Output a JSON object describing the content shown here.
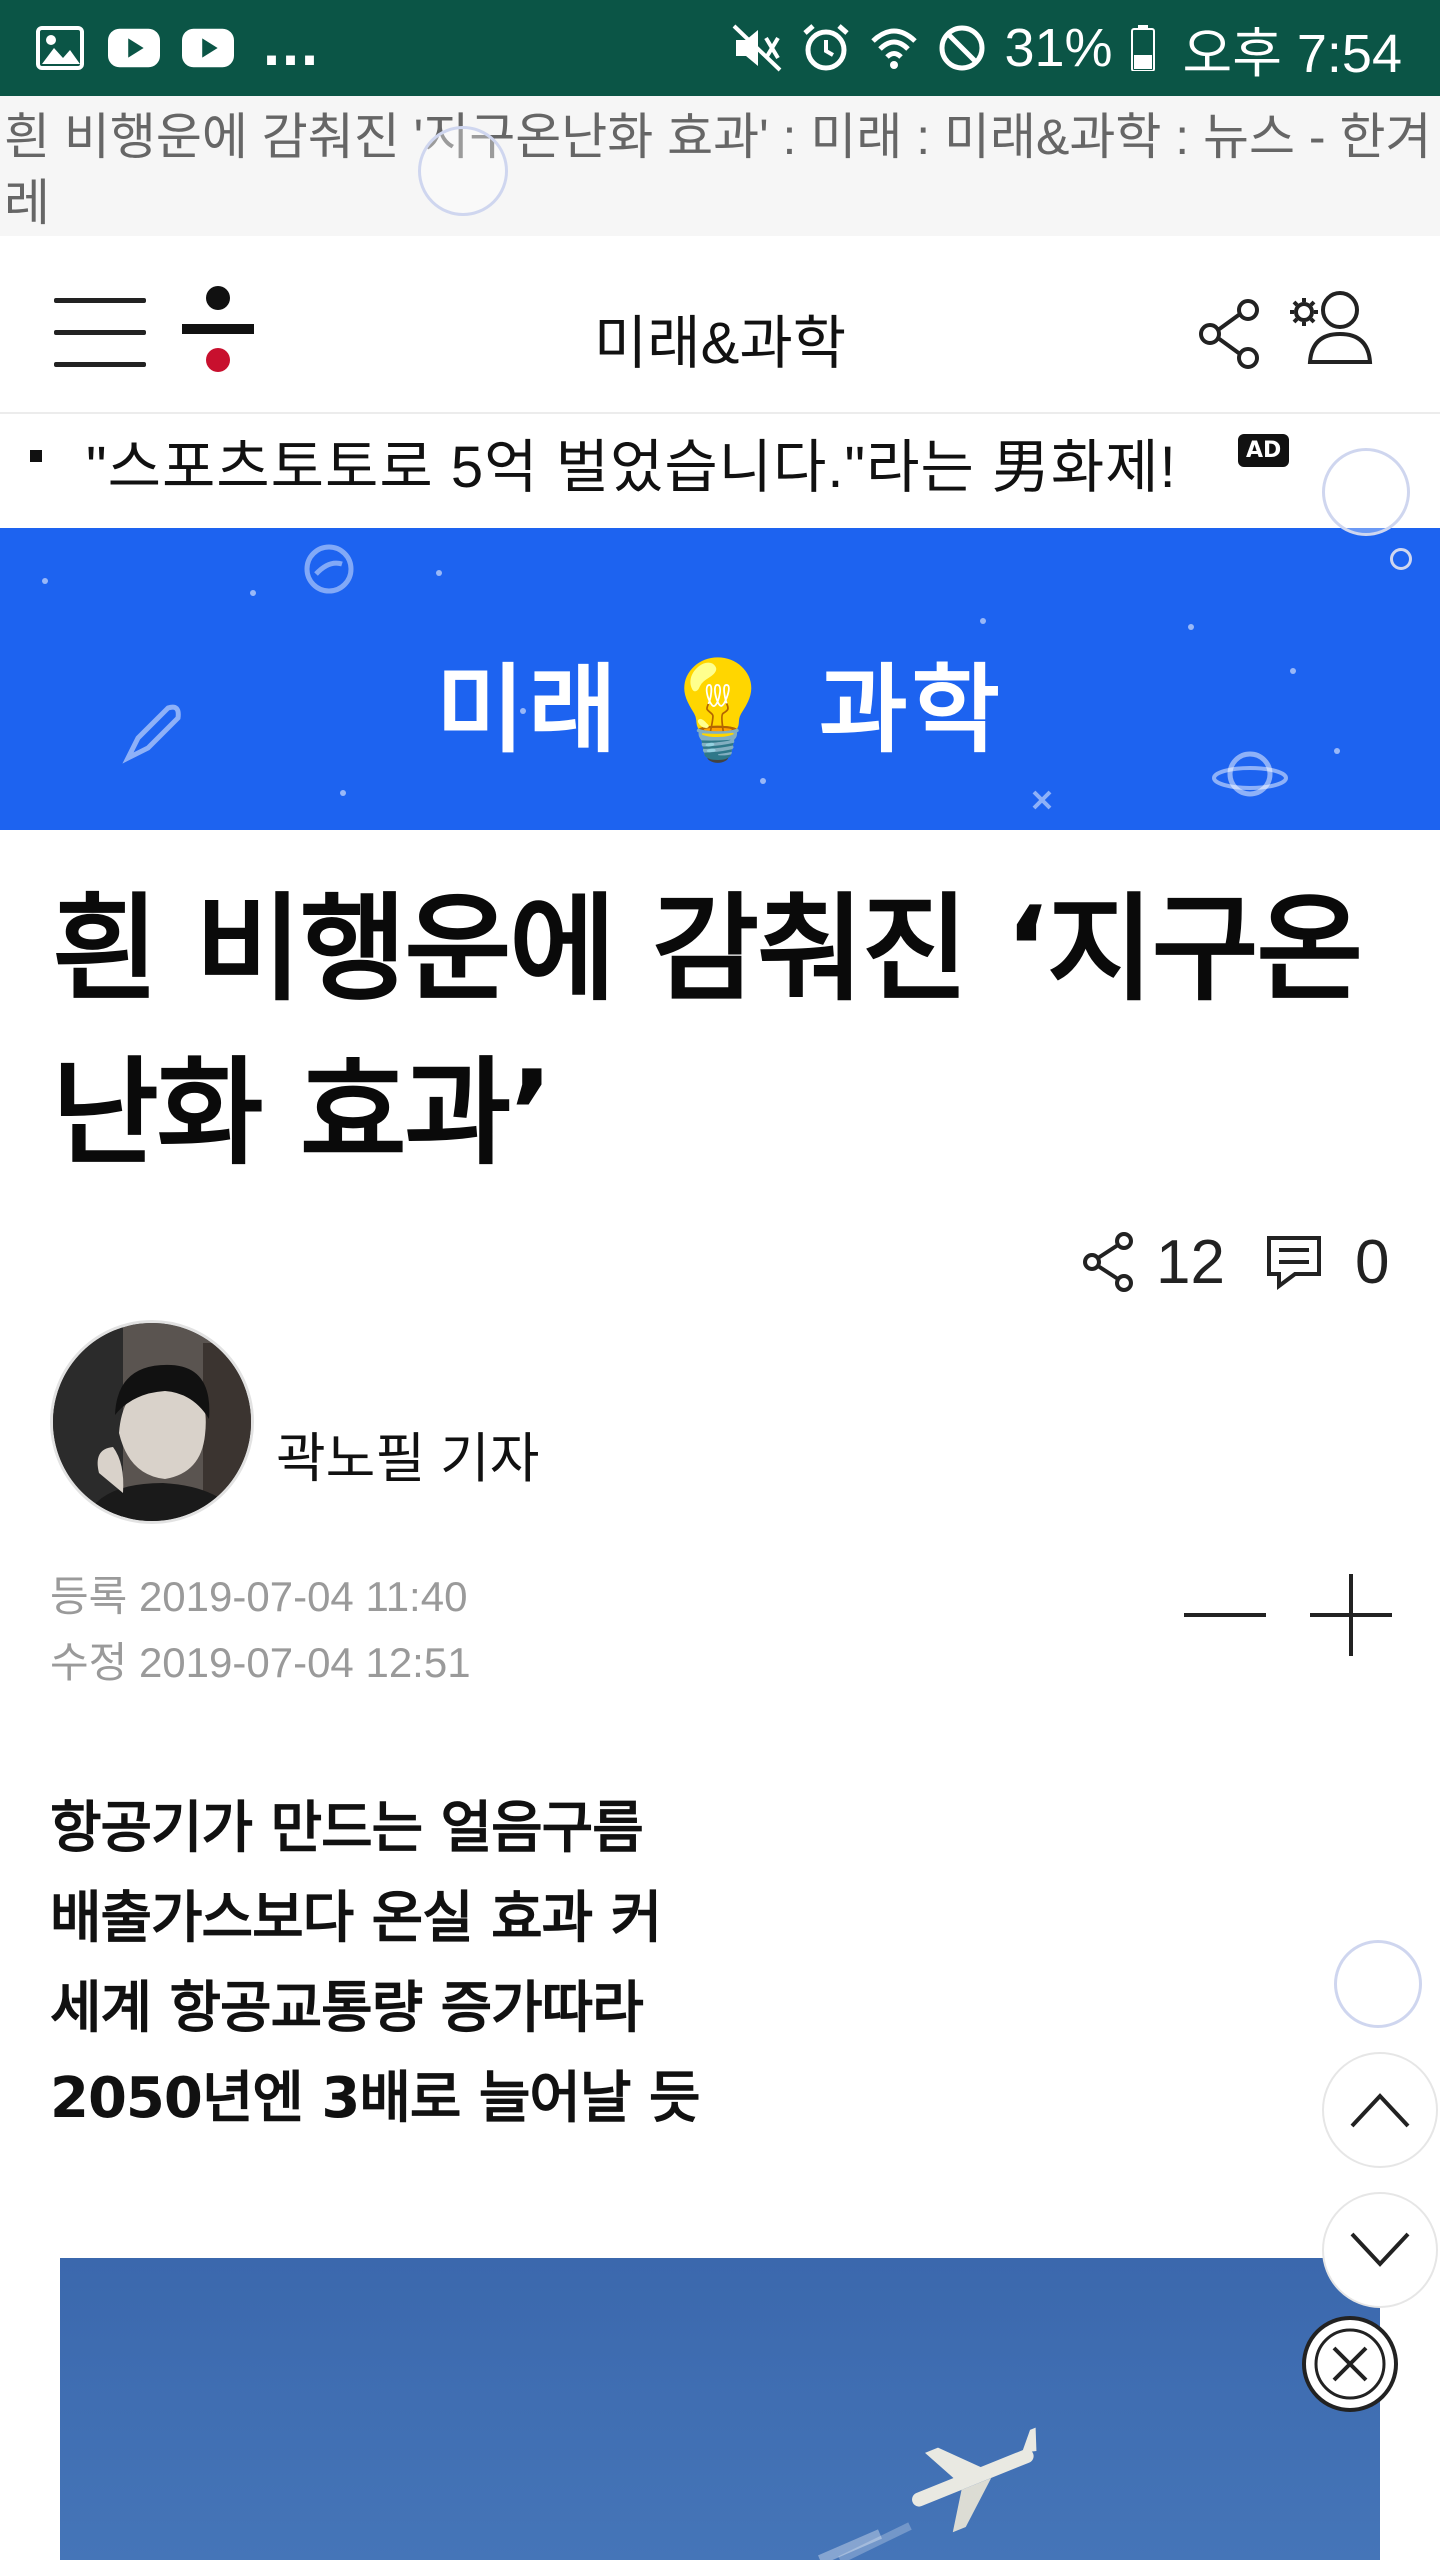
{
  "status_bar": {
    "battery": "31%",
    "time": "오후 7:54",
    "more": "..."
  },
  "page_title": "흰 비행운에 감춰진 '지구온난화 효과' : 미래 : 미래&과학 : 뉴스 - 한겨레",
  "header": {
    "section": "미래&과학"
  },
  "ticker": {
    "text": "\"스포츠토토로 5억 벌었습니다.\"라는 男화제!",
    "badge": "AD"
  },
  "banner": {
    "title": "미래 💡 과학"
  },
  "article": {
    "headline_line1": "흰 비행운에 감춰진 ‘지구온",
    "headline_line2": "난화 효과’",
    "share_count": "12",
    "comment_count": "0",
    "author": "곽노필 기자",
    "registered": "등록 2019-07-04 11:40",
    "modified": "수정 2019-07-04 12:51",
    "summary": [
      "항공기가 만드는 얼음구름",
      "배출가스보다 온실 효과 커",
      "세계 항공교통량 증가따라",
      "2050년엔 3배로 늘어날 듯"
    ]
  },
  "icons": {
    "gallery": "image-icon",
    "youtube": "youtube-icon",
    "mute": "mute-icon",
    "alarm": "alarm-icon",
    "wifi": "wifi-icon",
    "dnd": "do-not-disturb-icon",
    "battery": "battery-icon"
  },
  "colors": {
    "status_bar": "#0b5546",
    "banner": "#1d63f0",
    "logo_accent": "#c8102e"
  }
}
